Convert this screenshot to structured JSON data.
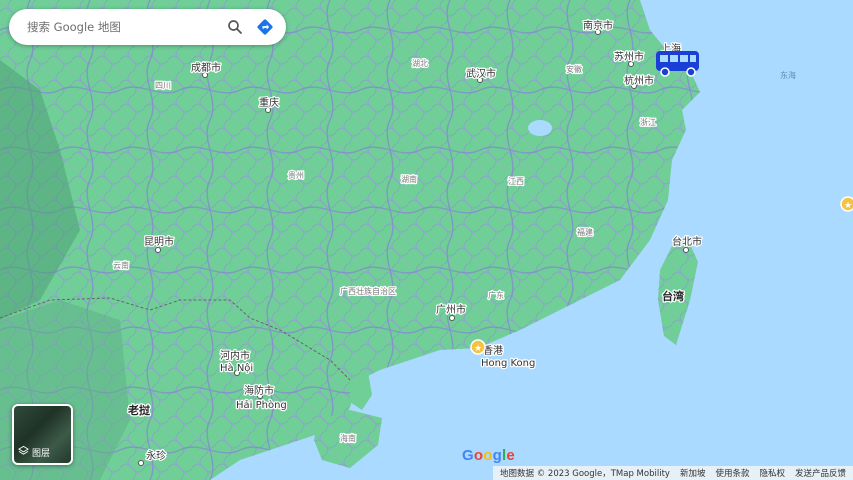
{
  "search": {
    "placeholder": "搜索 Google 地图"
  },
  "icons": {
    "search": "search-icon",
    "directions": "directions-icon",
    "layers": "layers-icon",
    "bus": "bus-icon",
    "star_marker": "star-marker-icon"
  },
  "layers_button": {
    "label": "图层"
  },
  "map_labels": {
    "nanjing": "南京市",
    "suzhou": "苏州市",
    "shanghai": "上海",
    "hangzhou": "杭州市",
    "donghai": "东海",
    "wuhan": "武汉市",
    "chengdu": "成都市",
    "chongqing": "重庆",
    "sichuan": "四川",
    "hubei": "湖北",
    "anhui": "安徽",
    "zhejiang": "浙江",
    "guizhou": "贵州",
    "hunan": "湖南",
    "jiangxi": "江西",
    "fujian": "福建",
    "kunming": "昆明市",
    "yunnan": "云南",
    "guangxi": "广西壮族自治区",
    "guangdong": "广东",
    "guangzhou": "广州市",
    "taipei": "台北市",
    "taiwan": "台湾",
    "hongkong_cn": "香港",
    "hongkong_en": "Hong Kong",
    "hanoi_cn": "河内市",
    "hanoi_en": "Hà Nội",
    "haiphong_cn": "海防市",
    "haiphong_en": "Hải Phòng",
    "laos": "老挝",
    "vientiane": "永珍",
    "hainan": "海南"
  },
  "footer": {
    "attribution": "地图数据 © 2023 Google，TMap Mobility",
    "singapore": "新加坡",
    "terms": "使用条款",
    "privacy": "隐私权",
    "feedback": "发送产品反馈"
  },
  "logo": {
    "letters": [
      "G",
      "o",
      "o",
      "g",
      "l",
      "e"
    ]
  },
  "colors": {
    "water": "#aadaff",
    "land": "#6fcf97",
    "roads": "#8e9ad1",
    "bus": "#1a3fd6",
    "star": "#f5c242"
  }
}
